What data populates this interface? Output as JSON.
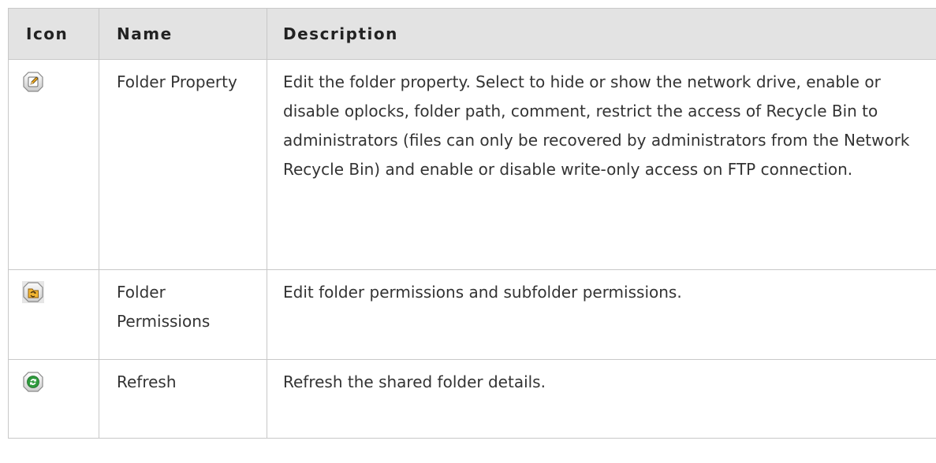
{
  "table": {
    "headers": {
      "icon": "Icon",
      "name": "Name",
      "description": "Description"
    },
    "rows": [
      {
        "icon": "edit-pencil-icon",
        "name": "Folder Property",
        "description": "Edit the folder property. Select to hide or show the network drive, enable or disable oplocks, folder path, comment, restrict the access of Recycle Bin to administrators (files can only be recovered by administrators from the Network Recycle Bin) and enable or disable write-only access on FTP connection."
      },
      {
        "icon": "folder-permissions-icon",
        "name": "Folder Permissions",
        "description": "Edit folder permissions and subfolder permissions."
      },
      {
        "icon": "refresh-icon",
        "name": "Refresh",
        "description": "Refresh the shared folder details."
      }
    ]
  },
  "colors": {
    "header_bg": "#e3e3e3",
    "border": "#c8c8c8",
    "text": "#333333"
  }
}
